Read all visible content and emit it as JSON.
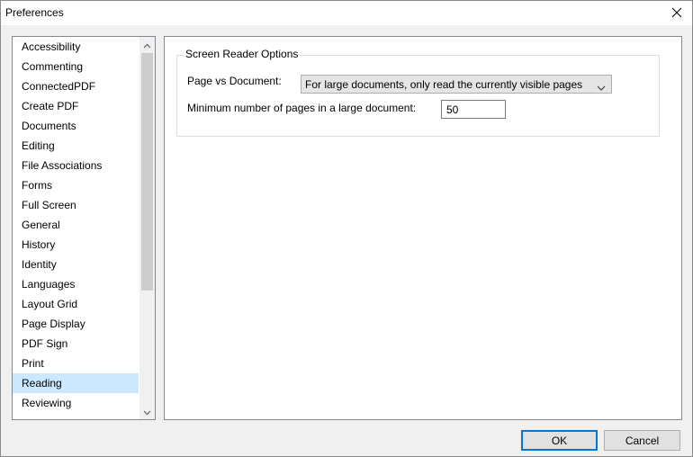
{
  "window": {
    "title": "Preferences",
    "close_icon": "close-icon"
  },
  "sidebar": {
    "items": [
      {
        "label": "Accessibility",
        "selected": false
      },
      {
        "label": "Commenting",
        "selected": false
      },
      {
        "label": "ConnectedPDF",
        "selected": false
      },
      {
        "label": "Create PDF",
        "selected": false
      },
      {
        "label": "Documents",
        "selected": false
      },
      {
        "label": "Editing",
        "selected": false
      },
      {
        "label": "File Associations",
        "selected": false
      },
      {
        "label": "Forms",
        "selected": false
      },
      {
        "label": "Full Screen",
        "selected": false
      },
      {
        "label": "General",
        "selected": false
      },
      {
        "label": "History",
        "selected": false
      },
      {
        "label": "Identity",
        "selected": false
      },
      {
        "label": "Languages",
        "selected": false
      },
      {
        "label": "Layout Grid",
        "selected": false
      },
      {
        "label": "Page Display",
        "selected": false
      },
      {
        "label": "PDF Sign",
        "selected": false
      },
      {
        "label": "Print",
        "selected": false
      },
      {
        "label": "Reading",
        "selected": true
      },
      {
        "label": "Reviewing",
        "selected": false
      }
    ],
    "selected_color": "#cce8ff"
  },
  "reading": {
    "group_title": "Screen Reader Options",
    "page_vs_document_label": "Page vs Document:",
    "page_vs_document_value": "For large documents, only read the currently visible pages",
    "min_pages_label": "Minimum number of pages in a large document:",
    "min_pages_value": "50"
  },
  "footer": {
    "ok_label": "OK",
    "cancel_label": "Cancel",
    "ok_border_color": "#0078d7"
  }
}
